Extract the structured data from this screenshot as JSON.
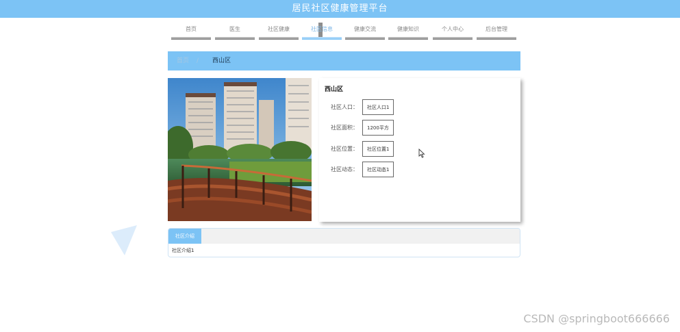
{
  "app": {
    "title": "居民社区健康管理平台"
  },
  "nav": {
    "items": [
      {
        "label": "首页"
      },
      {
        "label": "医生"
      },
      {
        "label": "社区健康"
      },
      {
        "label": "社区信息"
      },
      {
        "label": "健康交流"
      },
      {
        "label": "健康知识"
      },
      {
        "label": "个人中心"
      },
      {
        "label": "后台管理"
      }
    ],
    "active": "社区信息"
  },
  "breadcrumb": {
    "home": "首页",
    "separator": "/",
    "current": "西山区"
  },
  "community": {
    "name": "西山区",
    "fields": [
      {
        "label": "社区人口：",
        "value": "社区人口1"
      },
      {
        "label": "社区面积：",
        "value": "1200平方"
      },
      {
        "label": "社区位置：",
        "value": "社区位置1"
      },
      {
        "label": "社区动态：",
        "value": "社区动态1"
      }
    ]
  },
  "intro": {
    "tab_label": "社区介绍",
    "content": "社区介绍1"
  },
  "watermark": "CSDN @springboot666666",
  "colors": {
    "accent": "#7cc3f5",
    "nav_bar": "#8e8e8e"
  }
}
